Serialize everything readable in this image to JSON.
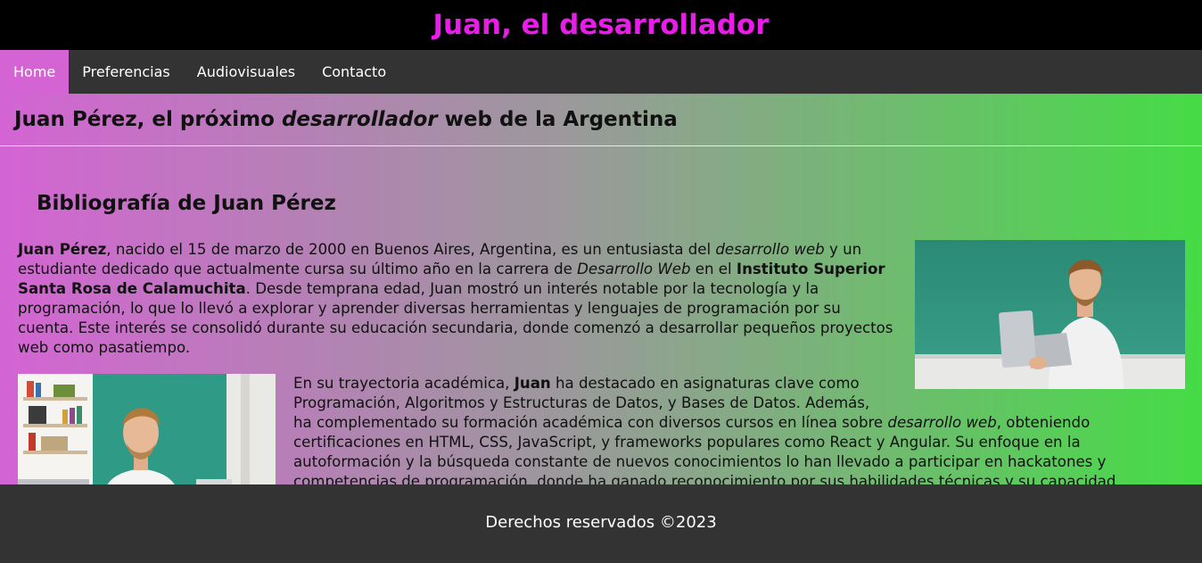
{
  "site": {
    "title": "Juan, el desarrollador"
  },
  "nav": {
    "items": [
      {
        "label": "Home"
      },
      {
        "label": "Preferencias"
      },
      {
        "label": "Audiovisuales"
      },
      {
        "label": "Contacto"
      }
    ]
  },
  "headline": {
    "part1": "Juan Pérez, el próximo ",
    "emph": "desarrollador",
    "part2": " web de la Argentina"
  },
  "bio": {
    "title": "Bibliografía de Juan Pérez",
    "p1": {
      "name": "Juan Pérez",
      "t1": ", nacido el 15 de marzo de 2000 en Buenos Aires, Argentina, es un entusiasta del ",
      "i1": "desarrollo web",
      "t2": " y un estudiante dedicado que actualmente cursa su último año en la carrera de ",
      "i2": "Desarrollo Web",
      "t3": " en el ",
      "b2": "Instituto Superior Santa Rosa de Calamuchita",
      "t4": ". Desde temprana edad, Juan mostró un interés notable por la tecnología y la programación, lo que lo llevó a explorar y aprender diversas herramientas y lenguajes de programación por su cuenta. Este interés se consolidó durante su educación secundaria, donde comenzó a desarrollar pequeños proyectos web como pasatiempo."
    },
    "p2": {
      "t1": "En su trayectoria académica, ",
      "b1": "Juan",
      "t2": " ha destacado en asignaturas clave como Programación, Algoritmos y Estructuras de Datos, y Bases de Datos. Además,",
      "t3": "ha complementado su formación académica con diversos cursos en línea sobre ",
      "i1": "desarrollo web",
      "t4": ", obteniendo certificaciones en HTML, CSS, JavaScript, y frameworks populares como React y Angular. Su enfoque en la autoformación y la búsqueda constante de nuevos conocimientos lo han llevado a participar en hackatones y competencias de programación, donde ha ganado reconocimiento por sus habilidades técnicas y su capacidad"
    }
  },
  "footer": {
    "text": "Derechos reservados ©2023"
  },
  "colors": {
    "title": "#e81ee8",
    "nav_active": "#d464d4",
    "gradient_left": "#d464d4",
    "gradient_right": "#45dc45"
  }
}
